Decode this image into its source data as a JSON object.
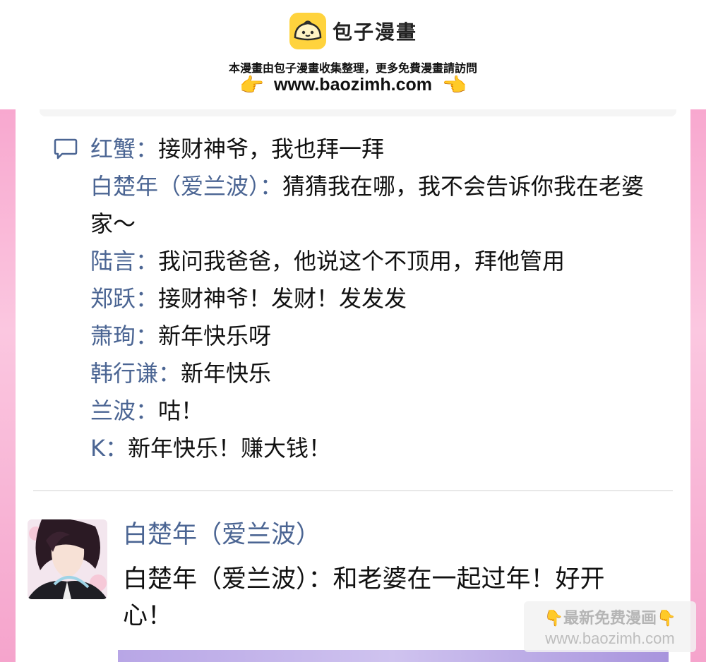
{
  "banner": {
    "brand": "包子漫畫",
    "tagline": "本漫畫由包子漫畫收集整理，更多免費漫畫請訪問",
    "url": "www.baozimh.com",
    "hand_right": "👉",
    "hand_left": "👈"
  },
  "comments": [
    {
      "name": "红蟹：",
      "text": "接财神爷，我也拜一拜"
    },
    {
      "name": "白楚年（爱兰波）：",
      "text": "猜猜我在哪，我不会告诉你我在老婆家～"
    },
    {
      "name": "陆言：",
      "text": "我问我爸爸，他说这个不顶用，拜他管用"
    },
    {
      "name": "郑跃：",
      "text": "接财神爷！发财！发发发"
    },
    {
      "name": "萧珣：",
      "text": "新年快乐呀"
    },
    {
      "name": "韩行谦：",
      "text": "新年快乐"
    },
    {
      "name": "兰波：",
      "text": "咕！"
    },
    {
      "name": "K：",
      "text": "新年快乐！赚大钱！"
    }
  ],
  "post": {
    "author": "白楚年（爱兰波）",
    "text": "白楚年（爱兰波）：和老婆在一起过年！好开心！"
  },
  "watermark": {
    "line1": "最新免费漫画",
    "line2": "www.baozimh.com",
    "hand": "👇"
  },
  "colors": {
    "name_blue": "#4b6593",
    "frame_pink": "#f8a8cf",
    "logo_yellow": "#ffd33d"
  }
}
